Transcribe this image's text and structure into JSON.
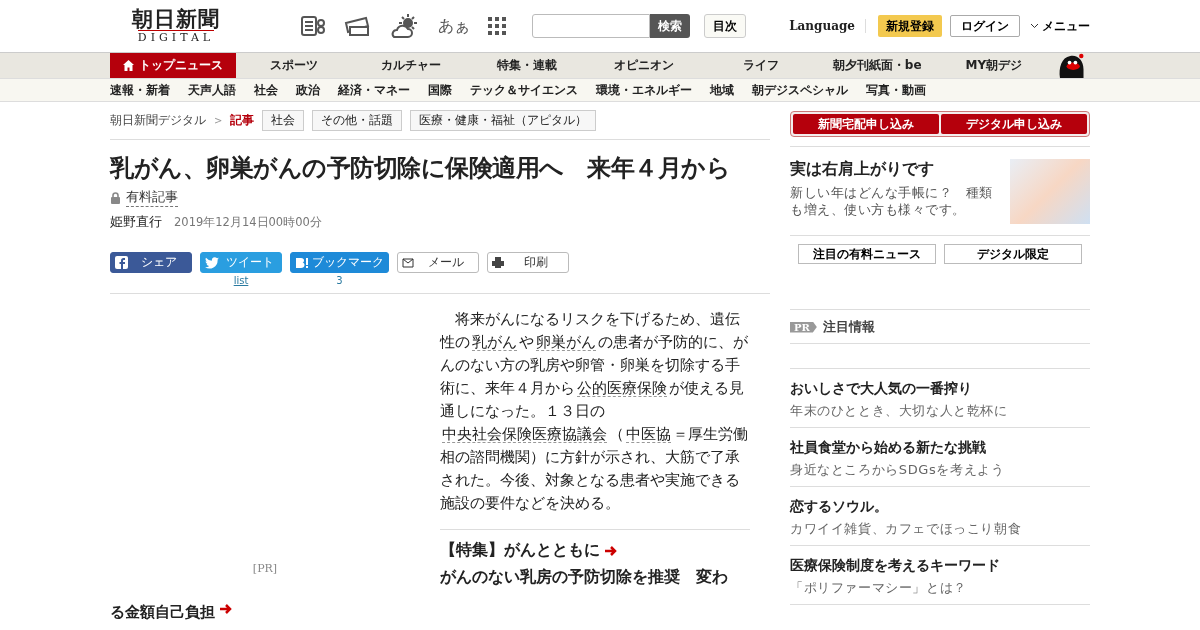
{
  "header": {
    "logo_main": "朝日新聞",
    "logo_sub": "DIGITAL",
    "search_button": "検索",
    "index_button": "目次",
    "language": "Language",
    "register": "新規登録",
    "login": "ログイン",
    "menu": "メニュー",
    "font_toggle": "あぁ"
  },
  "main_nav": [
    {
      "label": "トップニュース",
      "selected": true
    },
    {
      "label": "スポーツ",
      "selected": false
    },
    {
      "label": "カルチャー",
      "selected": false
    },
    {
      "label": "特集・連載",
      "selected": false
    },
    {
      "label": "オピニオン",
      "selected": false
    },
    {
      "label": "ライフ",
      "selected": false
    },
    {
      "label": "朝夕刊紙面・be",
      "selected": false
    },
    {
      "label": "MY朝デジ",
      "selected": false
    }
  ],
  "sub_nav": [
    "速報・新着",
    "天声人語",
    "社会",
    "政治",
    "経済・マネー",
    "国際",
    "テック＆サイエンス",
    "環境・エネルギー",
    "地域",
    "朝デジスペシャル",
    "写真・動画"
  ],
  "breadcrumb": [
    {
      "label": "朝日新聞デジタル",
      "current": false
    },
    {
      "label": "記事",
      "current": true
    }
  ],
  "breadcrumb_separator": ">",
  "tags": [
    "社会",
    "その他・話題",
    "医療・健康・福祉（アピタル）"
  ],
  "article": {
    "title": "乳がん、卵巣がんの予防切除に保険適用へ　来年４月から",
    "paid_label": "有料記事",
    "author": "姫野直行",
    "date": "2019年12月14日00時00分",
    "share": [
      {
        "kind": "facebook",
        "label": "シェア"
      },
      {
        "kind": "twitter",
        "label": "ツイート",
        "count": "list"
      },
      {
        "kind": "hatena",
        "label": "ブックマーク",
        "count": "3"
      },
      {
        "kind": "mail",
        "label": "メール"
      },
      {
        "kind": "print",
        "label": "印刷"
      }
    ],
    "pr_label": "[PR]",
    "left_teaser": "る金額自己負担",
    "body": [
      {
        "text": "　将来がんになるリスクを下げるため、遺伝性の",
        "link": false
      },
      {
        "text": "乳がん",
        "link": true
      },
      {
        "text": "や",
        "link": false
      },
      {
        "text": "卵巣がん",
        "link": true
      },
      {
        "text": "の患者が予防的に、がんのない方の乳房や卵管・卵巣を切除する手術に、来年４月から",
        "link": false
      },
      {
        "text": "公的医療保険",
        "link": true
      },
      {
        "text": "が使える見通しになった。１３日の",
        "link": false
      },
      {
        "text": "中央社会保険医療協議会",
        "link": true
      },
      {
        "text": "（",
        "link": false
      },
      {
        "text": "中医協",
        "link": true
      },
      {
        "text": "＝厚生労働相の諮問機関）に方針が示され、大筋で了承された。今後、対象となる患者や実施できる施設の要件などを決める。",
        "link": false
      }
    ],
    "feature_link": "【特集】がんとともに",
    "related_title": "がんのない乳房の予防切除を推奨　変わ"
  },
  "sidebar": {
    "subscribe": [
      "新聞宅配申し込み",
      "デジタル申し込み"
    ],
    "promo": {
      "title": "実は右肩上がりです",
      "text": "新しい年はどんな手帳に？　種類も増え、使い方も様々です。"
    },
    "tabs": [
      "注目の有料ニュース",
      "デジタル限定"
    ],
    "pr_badge": "PR",
    "pr_heading": "注目情報",
    "pr_items": [
      {
        "title": "おいしさで大人気の一番搾り",
        "text": "年末のひととき、大切な人と乾杯に"
      },
      {
        "title": "社員食堂から始める新たな挑戦",
        "text": "身近なところからSDGsを考えよう"
      },
      {
        "title": "恋するソウル。",
        "text": "カワイイ雑貨、カフェでほっこり朝食"
      },
      {
        "title": "医療保険制度を考えるキーワード",
        "text": "「ポリファーマシー」とは？"
      }
    ]
  }
}
